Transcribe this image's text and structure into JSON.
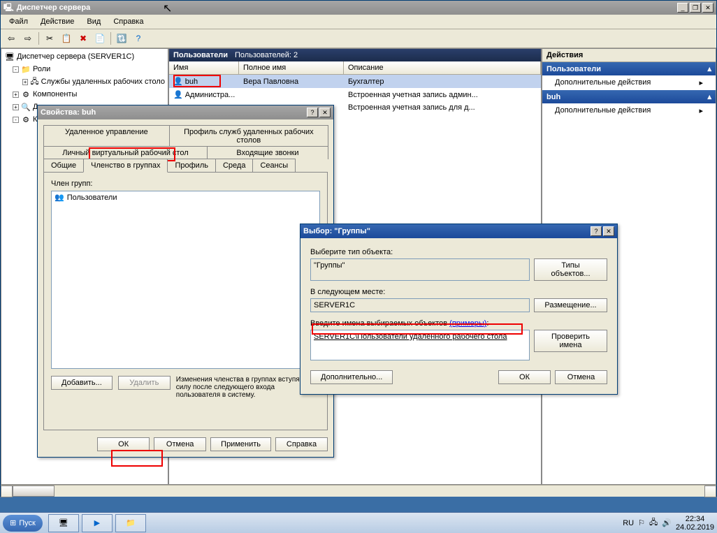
{
  "main_window": {
    "title": "Диспетчер сервера",
    "menubar": [
      "Файл",
      "Действие",
      "Вид",
      "Справка"
    ]
  },
  "tree": {
    "root": "Диспетчер сервера (SERVER1C)",
    "nodes": {
      "roles": "Роли",
      "rds": "Службы удаленных рабочих столо",
      "components": "Компоненты",
      "diagnostics": "Диагностика",
      "k": "К"
    }
  },
  "users_panel": {
    "header": "Пользователи",
    "count_label": "Пользователей: 2",
    "cols": {
      "name": "Имя",
      "fullname": "Полное имя",
      "desc": "Описание"
    },
    "rows": [
      {
        "name": "buh",
        "fullname": "Вера Павловна",
        "desc": "Бухгалтер"
      },
      {
        "name": "Администра...",
        "fullname": "",
        "desc": "Встроенная учетная запись админ..."
      },
      {
        "name": "",
        "fullname": "",
        "desc": "Встроенная учетная запись для д..."
      }
    ]
  },
  "actions": {
    "header": "Действия",
    "section1": "Пользователи",
    "item1": "Дополнительные действия",
    "section2": "buh",
    "item2": "Дополнительные действия"
  },
  "props_dialog": {
    "title": "Свойства: buh",
    "tabs_row1": [
      "Удаленное управление",
      "Профиль служб удаленных рабочих столов"
    ],
    "tabs_row2": [
      "Личный виртуальный рабочий стол",
      "Входящие звонки"
    ],
    "tabs_row3": [
      "Общие",
      "Членство в группах",
      "Профиль",
      "Среда",
      "Сеансы"
    ],
    "member_label": "Член групп:",
    "group_item": "Пользователи",
    "add_btn": "Добавить...",
    "remove_btn": "Удалить",
    "note": "Изменения членства в группах вступят в силу после следующего входа пользователя в систему.",
    "ok": "ОК",
    "cancel": "Отмена",
    "apply": "Применить",
    "help": "Справка"
  },
  "select_dialog": {
    "title": "Выбор: \"Группы\"",
    "obj_type_label": "Выберите тип объекта:",
    "obj_type_value": "\"Группы\"",
    "obj_type_btn": "Типы объектов...",
    "location_label": "В следующем месте:",
    "location_value": "SERVER1C",
    "location_btn": "Размещение...",
    "names_label": "Введите имена выбираемых объектов",
    "names_link": "(примеры)",
    "names_value": "SERVER1C\\Пользователи удаленного рабочего стола",
    "check_btn": "Проверить имена",
    "advanced_btn": "Дополнительно...",
    "ok": "ОК",
    "cancel": "Отмена"
  },
  "taskbar": {
    "start": "Пуск",
    "lang": "RU",
    "time": "22:34",
    "date": "24.02.2019"
  }
}
